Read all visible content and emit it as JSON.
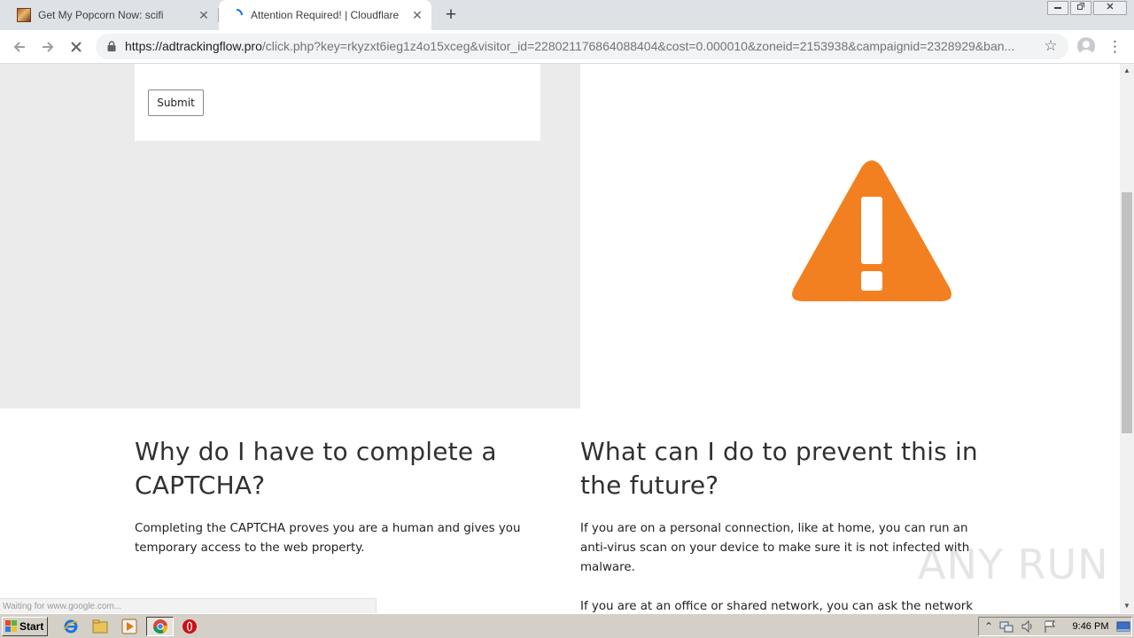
{
  "browser": {
    "tabs": [
      {
        "title": "Get My Popcorn Now: scifi",
        "active": false,
        "favicon": "popcorn-thumbnail-icon"
      },
      {
        "title": "Attention Required! | Cloudflare",
        "active": true,
        "favicon": "loading-spinner-icon"
      }
    ],
    "new_tab_label": "+",
    "close_label": "✕",
    "url_host": "https://adtrackingflow.pro",
    "url_path": "/click.php?key=rkyzxt6ieg1z4o15xceg&visitor_id=228021176864088404&cost=0.000010&zoneid=2153938&campaignid=2328929&ban...",
    "loading": true
  },
  "page": {
    "submit_label": "Submit",
    "why": {
      "heading": "Why do I have to complete a CAPTCHA?",
      "body": "Completing the CAPTCHA proves you are a human and gives you temporary access to the web property."
    },
    "prevent": {
      "heading": "What can I do to prevent this in the future?",
      "body1": "If you are on a personal connection, like at home, you can run an anti-virus scan on your device to make sure it is not infected with malware.",
      "body2": "If you are at an office or shared network, you can ask the network"
    },
    "status_text": "Waiting for www.google.com...",
    "watermark": "ANY RUN",
    "warning_color": "#f38020"
  },
  "taskbar": {
    "start_label": "Start",
    "clock": "9:46 PM"
  }
}
